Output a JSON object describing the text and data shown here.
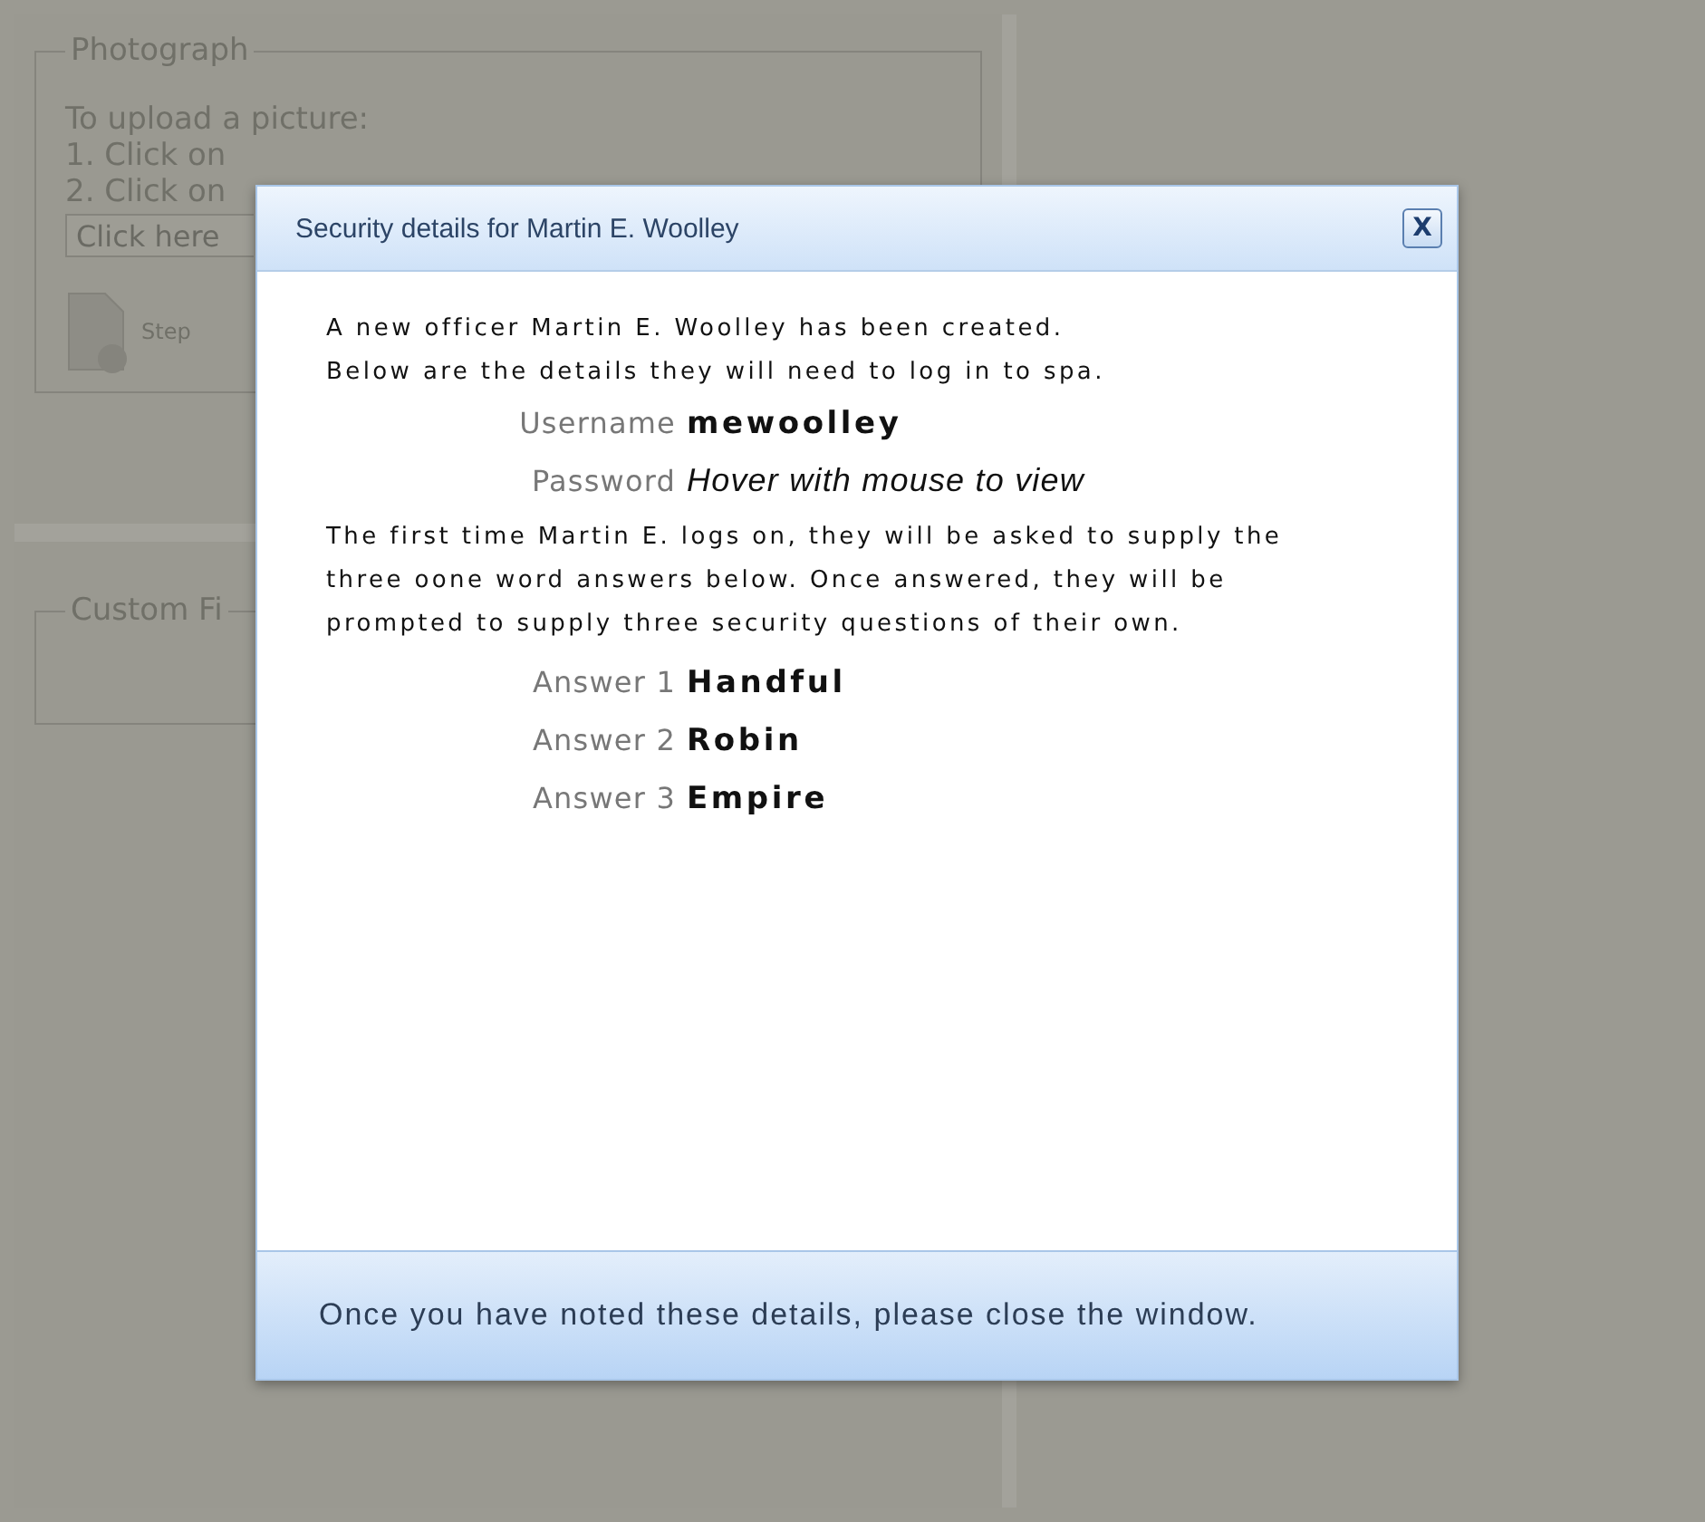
{
  "background": {
    "photograph": {
      "legend": "Photograph",
      "lines": [
        "To upload a picture:",
        "1. Click on",
        "2. Click on"
      ],
      "file_field": {
        "placeholder": "Click here"
      },
      "step": "Step"
    },
    "custom_fields": {
      "legend": "Custom Fi"
    }
  },
  "dialog": {
    "title": "Security details for Martin E. Woolley",
    "close": "X",
    "intro": [
      "A new officer Martin E. Woolley has been created.",
      "Below are the details they will need to log in to spa."
    ],
    "credentials": [
      {
        "label": "Username",
        "value": "mewoolley",
        "kind": "plain"
      },
      {
        "label": "Password",
        "value": "Hover with mouse to view",
        "kind": "hidden"
      }
    ],
    "note": "The first time Martin E. logs on, they will be asked to supply the three oone word answers below. Once answered, they will be prompted to supply three security questions of their own.",
    "answers": [
      {
        "label": "Answer 1",
        "value": "Handful"
      },
      {
        "label": "Answer 2",
        "value": "Robin"
      },
      {
        "label": "Answer 3",
        "value": "Empire"
      }
    ],
    "footer": "Once you have noted these details, please close the window."
  }
}
